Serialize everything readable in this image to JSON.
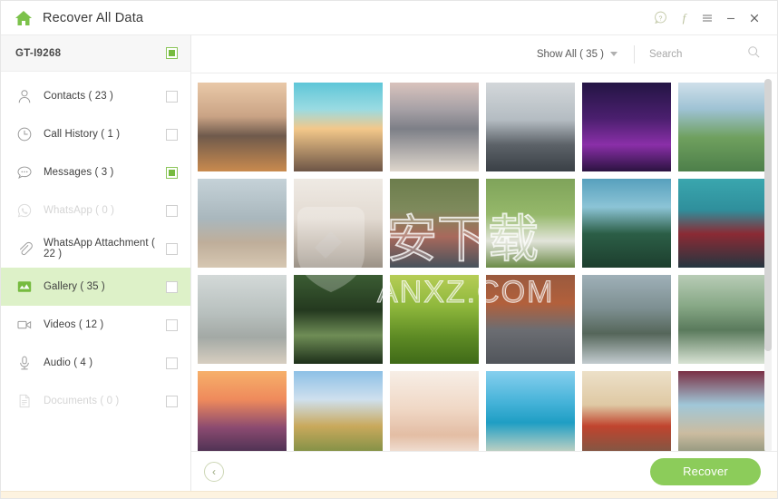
{
  "window": {
    "title": "Recover All Data",
    "home_icon": "home-icon",
    "controls": [
      {
        "name": "help-icon",
        "glyph": "?"
      },
      {
        "name": "facebook-icon",
        "glyph": "f"
      },
      {
        "name": "menu-icon",
        "glyph": "☰"
      },
      {
        "name": "minimize-icon",
        "glyph": "−"
      },
      {
        "name": "close-icon",
        "glyph": "✕"
      }
    ]
  },
  "sidebar": {
    "device": {
      "name": "GT-I9268",
      "checked": true
    },
    "items": [
      {
        "label": "Contacts ( 23 )",
        "icon": "contacts-icon",
        "checked": false,
        "active": false,
        "disabled": false
      },
      {
        "label": "Call History ( 1 )",
        "icon": "clock-icon",
        "checked": false,
        "active": false,
        "disabled": false
      },
      {
        "label": "Messages ( 3 )",
        "icon": "message-icon",
        "checked": true,
        "active": false,
        "disabled": false
      },
      {
        "label": "WhatsApp ( 0 )",
        "icon": "whatsapp-icon",
        "checked": false,
        "active": false,
        "disabled": true
      },
      {
        "label": "WhatsApp Attachment ( 22 )",
        "icon": "paperclip-icon",
        "checked": false,
        "active": false,
        "disabled": false
      },
      {
        "label": "Gallery ( 35 )",
        "icon": "gallery-icon",
        "checked": false,
        "active": true,
        "disabled": false
      },
      {
        "label": "Videos ( 12 )",
        "icon": "video-icon",
        "checked": false,
        "active": false,
        "disabled": false
      },
      {
        "label": "Audio ( 4 )",
        "icon": "microphone-icon",
        "checked": false,
        "active": false,
        "disabled": false
      },
      {
        "label": "Documents ( 0 )",
        "icon": "document-icon",
        "checked": false,
        "active": false,
        "disabled": true
      }
    ]
  },
  "toolbar": {
    "filter_label": "Show All ( 35 )",
    "search_value": "",
    "search_placeholder": "Search",
    "search_icon": "search-icon"
  },
  "gallery": {
    "columns": 6,
    "thumbnails": [
      {
        "alt": "modern house at dusk with lit windows",
        "c1": "#f3c99a",
        "c2": "#6e5b52",
        "c3": "#d9dbd6",
        "style": "house"
      },
      {
        "alt": "person doing handstand on cliff edge at sunrise",
        "c1": "#7fd3dd",
        "c2": "#f0b27a",
        "c3": "#6b5a4e",
        "style": "cliff"
      },
      {
        "alt": "desert sand dunes under pink cloudy sky",
        "c1": "#e8cfc6",
        "c2": "#8c8e94",
        "c3": "#d7cdc3",
        "style": "dunes"
      },
      {
        "alt": "city skyline with tall tower, overcast",
        "c1": "#cfd3d6",
        "c2": "#6f747a",
        "c3": "#3b4046",
        "style": "skyline"
      },
      {
        "alt": "night cityscape with neon purple skyscrapers",
        "c1": "#2a1b49",
        "c2": "#7a2fa0",
        "c3": "#1b1030",
        "style": "neon"
      },
      {
        "alt": "aerial view of river winding past a green city",
        "c1": "#cfe0ea",
        "c2": "#5d8f5a",
        "c3": "#86b0c9",
        "style": "aerial"
      },
      {
        "alt": "family with child on the beach at the shoreline",
        "c1": "#b7c6ce",
        "c2": "#9aa9b0",
        "c3": "#cbbfae",
        "style": "beachfamily"
      },
      {
        "alt": "bright white interior room with plants",
        "c1": "#ece7e2",
        "c2": "#cfc4bb",
        "c3": "#a8a096",
        "style": "interior"
      },
      {
        "alt": "crowd of people gathered outdoors",
        "c1": "#6b7b4a",
        "c2": "#b4584f",
        "c3": "#3c4a56",
        "style": "crowd"
      },
      {
        "alt": "friends sitting on grass in a park",
        "c1": "#8cae63",
        "c2": "#4a6b3a",
        "c3": "#e6e6e0",
        "style": "park"
      },
      {
        "alt": "forest and mountain vista with blue sky",
        "c1": "#4a8fb0",
        "c2": "#1f4a3a",
        "c3": "#2c5d48",
        "style": "forest"
      },
      {
        "alt": "superhero movie still with glowing armor",
        "c1": "#2f9aa3",
        "c2": "#8b2230",
        "c3": "#26363f",
        "style": "hero"
      },
      {
        "alt": "family silhouettes looking out over a lake",
        "c1": "#cfd6d6",
        "c2": "#a8b0ae",
        "c3": "#d6cec2",
        "style": "lakefamily"
      },
      {
        "alt": "stone arch bridge reflected as a circle in river",
        "c1": "#2f4a2a",
        "c2": "#1b2e1a",
        "c3": "#6d8a55",
        "style": "archbridge"
      },
      {
        "alt": "green terraced rice fields",
        "c1": "#a6c24a",
        "c2": "#4f7a22",
        "c3": "#c8d96a",
        "style": "terrace"
      },
      {
        "alt": "empty straight road through red desert mountains",
        "c1": "#8a4a35",
        "c2": "#5a5f66",
        "c3": "#b7603f",
        "style": "road"
      },
      {
        "alt": "winding mountain road above a valley",
        "c1": "#8fa0a8",
        "c2": "#4f6155",
        "c3": "#c2cbd0",
        "style": "winding"
      },
      {
        "alt": "karst mountains and boat on a calm river",
        "c1": "#8fb08a",
        "c2": "#4e6b52",
        "c3": "#d6e2d2",
        "style": "karst"
      },
      {
        "alt": "hot air balloons over mountains at sunset",
        "c1": "#f0a05a",
        "c2": "#7a3f6b",
        "c3": "#3a2a4a",
        "style": "balloons"
      },
      {
        "alt": "dirt road through open prairie with trees",
        "c1": "#7fb6e0",
        "c2": "#c9a55c",
        "c3": "#5a7a3a",
        "style": "dirtroad"
      },
      {
        "alt": "adult and baby feet forming a heart shape",
        "c1": "#f0d6c6",
        "c2": "#e0b8a2",
        "c3": "#fbf4ef",
        "style": "feet"
      },
      {
        "alt": "father and child walking on a tropical beach",
        "c1": "#76c5e8",
        "c2": "#1f9ec4",
        "c3": "#ead9b8",
        "style": "beachwalk"
      },
      {
        "alt": "child reading a picture book with parent",
        "c1": "#e8d9c0",
        "c2": "#c0442e",
        "c3": "#6b5a4a",
        "style": "book"
      },
      {
        "alt": "child in knit hat hugging an adult outdoors",
        "c1": "#7a3045",
        "c2": "#9fc6d8",
        "c3": "#c7b89e",
        "style": "hug"
      }
    ],
    "watermark_text": "安下载",
    "watermark_sub": "ANXZ.COM"
  },
  "footer": {
    "back_label": "‹",
    "recover_label": "Recover"
  },
  "colors": {
    "accent_green": "#8ccc5a",
    "active_row": "#ddf1c8",
    "checkbox_green": "#76bb3f",
    "bottom_band": "#fdf3e0"
  }
}
